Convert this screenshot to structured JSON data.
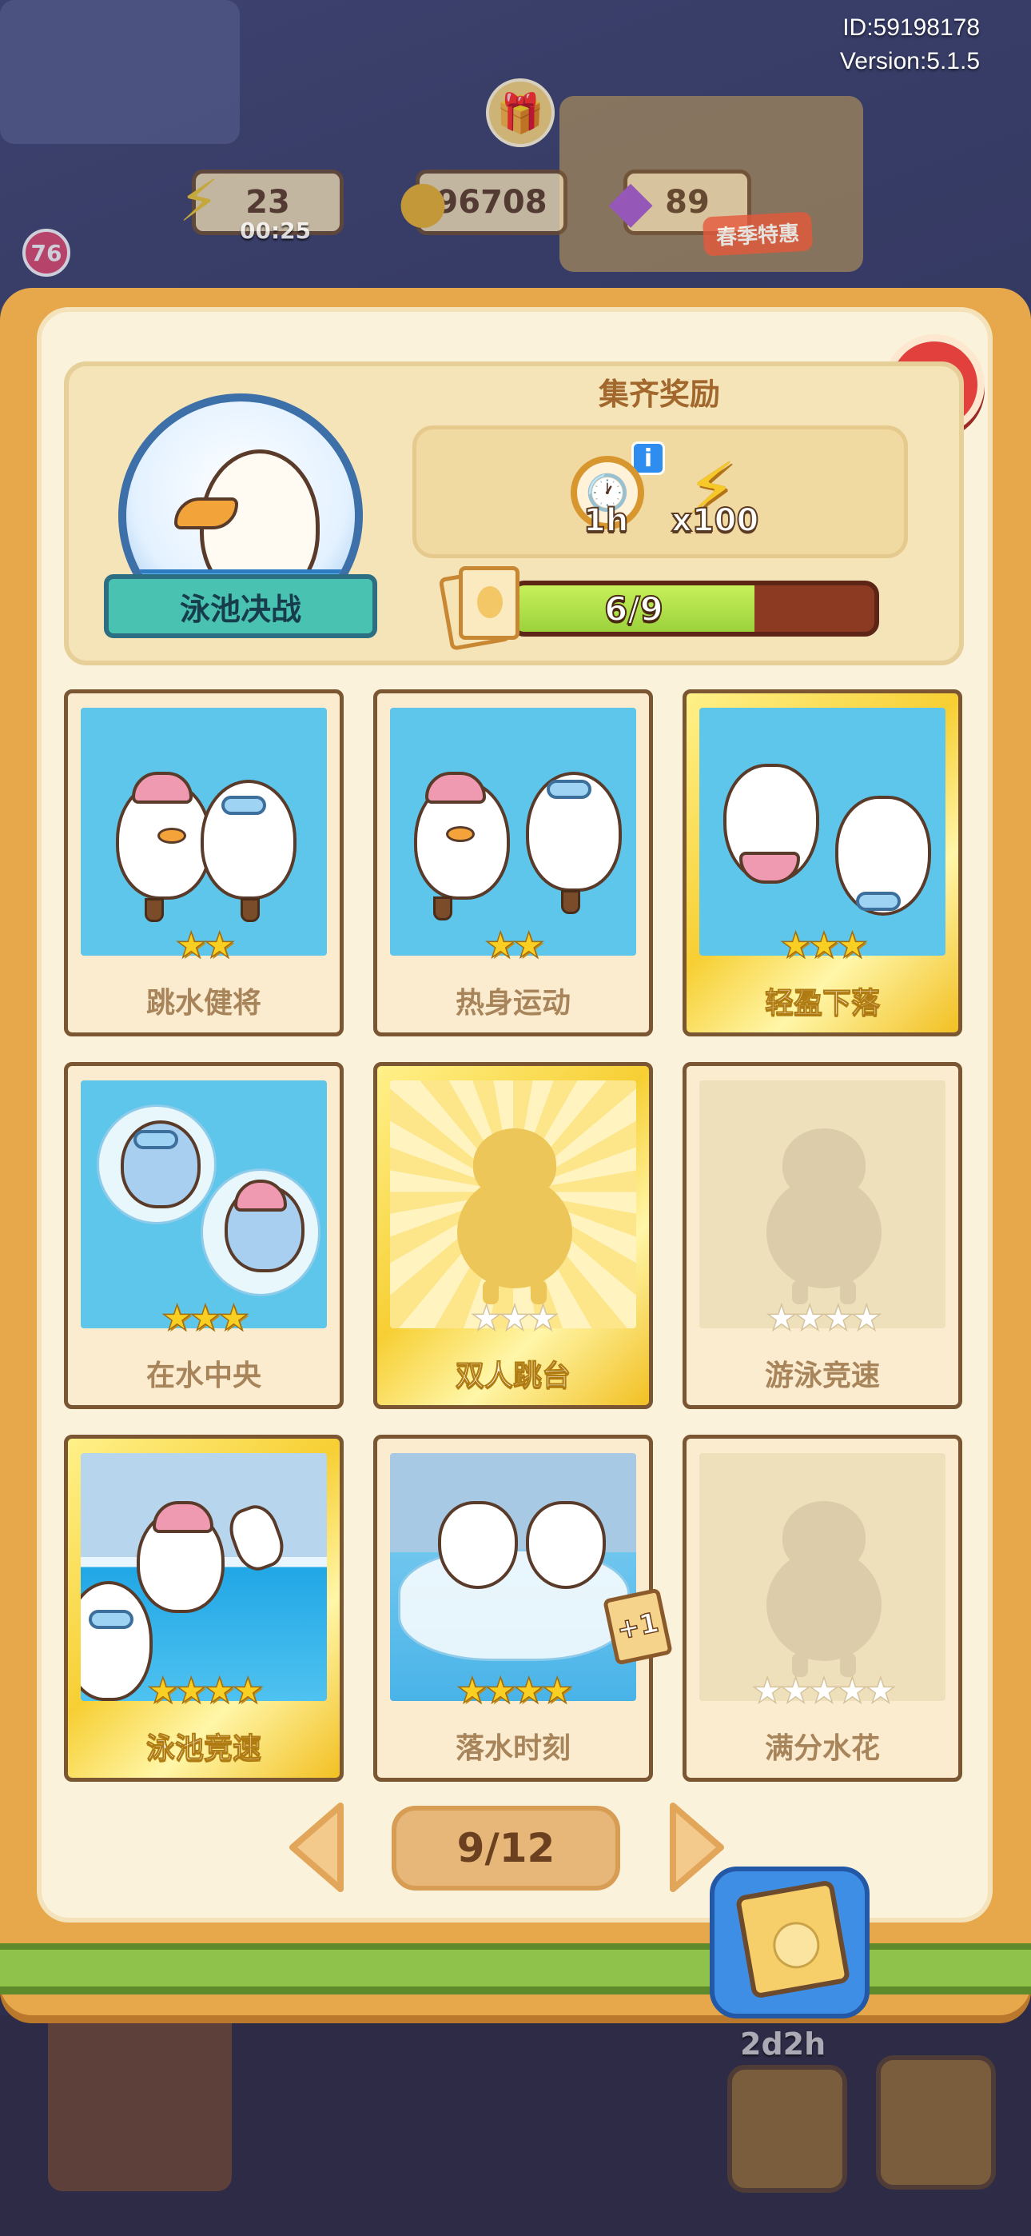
{
  "hud": {
    "id_line": "ID:59198178",
    "version_line": "Version:5.1.5",
    "energy_value": "23",
    "energy_timer": "00:25",
    "coins_value": "96708",
    "gems_value": "89",
    "player_level": "76",
    "promo_label": "春季特惠"
  },
  "album": {
    "theme_name": "泳池决战",
    "reward_title": "集齐奖励",
    "reward_items": [
      {
        "icon": "clock-icon",
        "label": "1h"
      },
      {
        "icon": "energy-bolt-icon",
        "label": "x100"
      }
    ],
    "progress": {
      "collected": 6,
      "total": 9,
      "text": "6/9",
      "fraction": 0.6667
    },
    "colors": {
      "progress_fill": "#b6e34a",
      "progress_track": "#8d3a23",
      "close": "#e2403d",
      "gold_card": "#f7cf33"
    },
    "cards": [
      {
        "name": "跳水健将",
        "stars_total": 2,
        "stars_earned": 2,
        "state": "owned",
        "frame": "blue"
      },
      {
        "name": "热身运动",
        "stars_total": 2,
        "stars_earned": 2,
        "state": "owned",
        "frame": "blue"
      },
      {
        "name": "轻盈下落",
        "stars_total": 3,
        "stars_earned": 3,
        "state": "owned",
        "frame": "gold"
      },
      {
        "name": "在水中央",
        "stars_total": 3,
        "stars_earned": 3,
        "state": "owned",
        "frame": "blue"
      },
      {
        "name": "双人跳台",
        "stars_total": 3,
        "stars_earned": 0,
        "state": "missing",
        "frame": "gold"
      },
      {
        "name": "游泳竞速",
        "stars_total": 4,
        "stars_earned": 0,
        "state": "missing",
        "frame": "plain"
      },
      {
        "name": "泳池竞速",
        "stars_total": 4,
        "stars_earned": 4,
        "state": "owned",
        "frame": "gold"
      },
      {
        "name": "落水时刻",
        "stars_total": 4,
        "stars_earned": 4,
        "state": "owned",
        "frame": "blue",
        "extra_badge": "+1"
      },
      {
        "name": "满分水花",
        "stars_total": 5,
        "stars_earned": 0,
        "state": "missing",
        "frame": "plain"
      }
    ],
    "pager": {
      "text": "9/12",
      "current": 9,
      "total": 12
    }
  },
  "bottom": {
    "album_timer": "2d2h"
  }
}
